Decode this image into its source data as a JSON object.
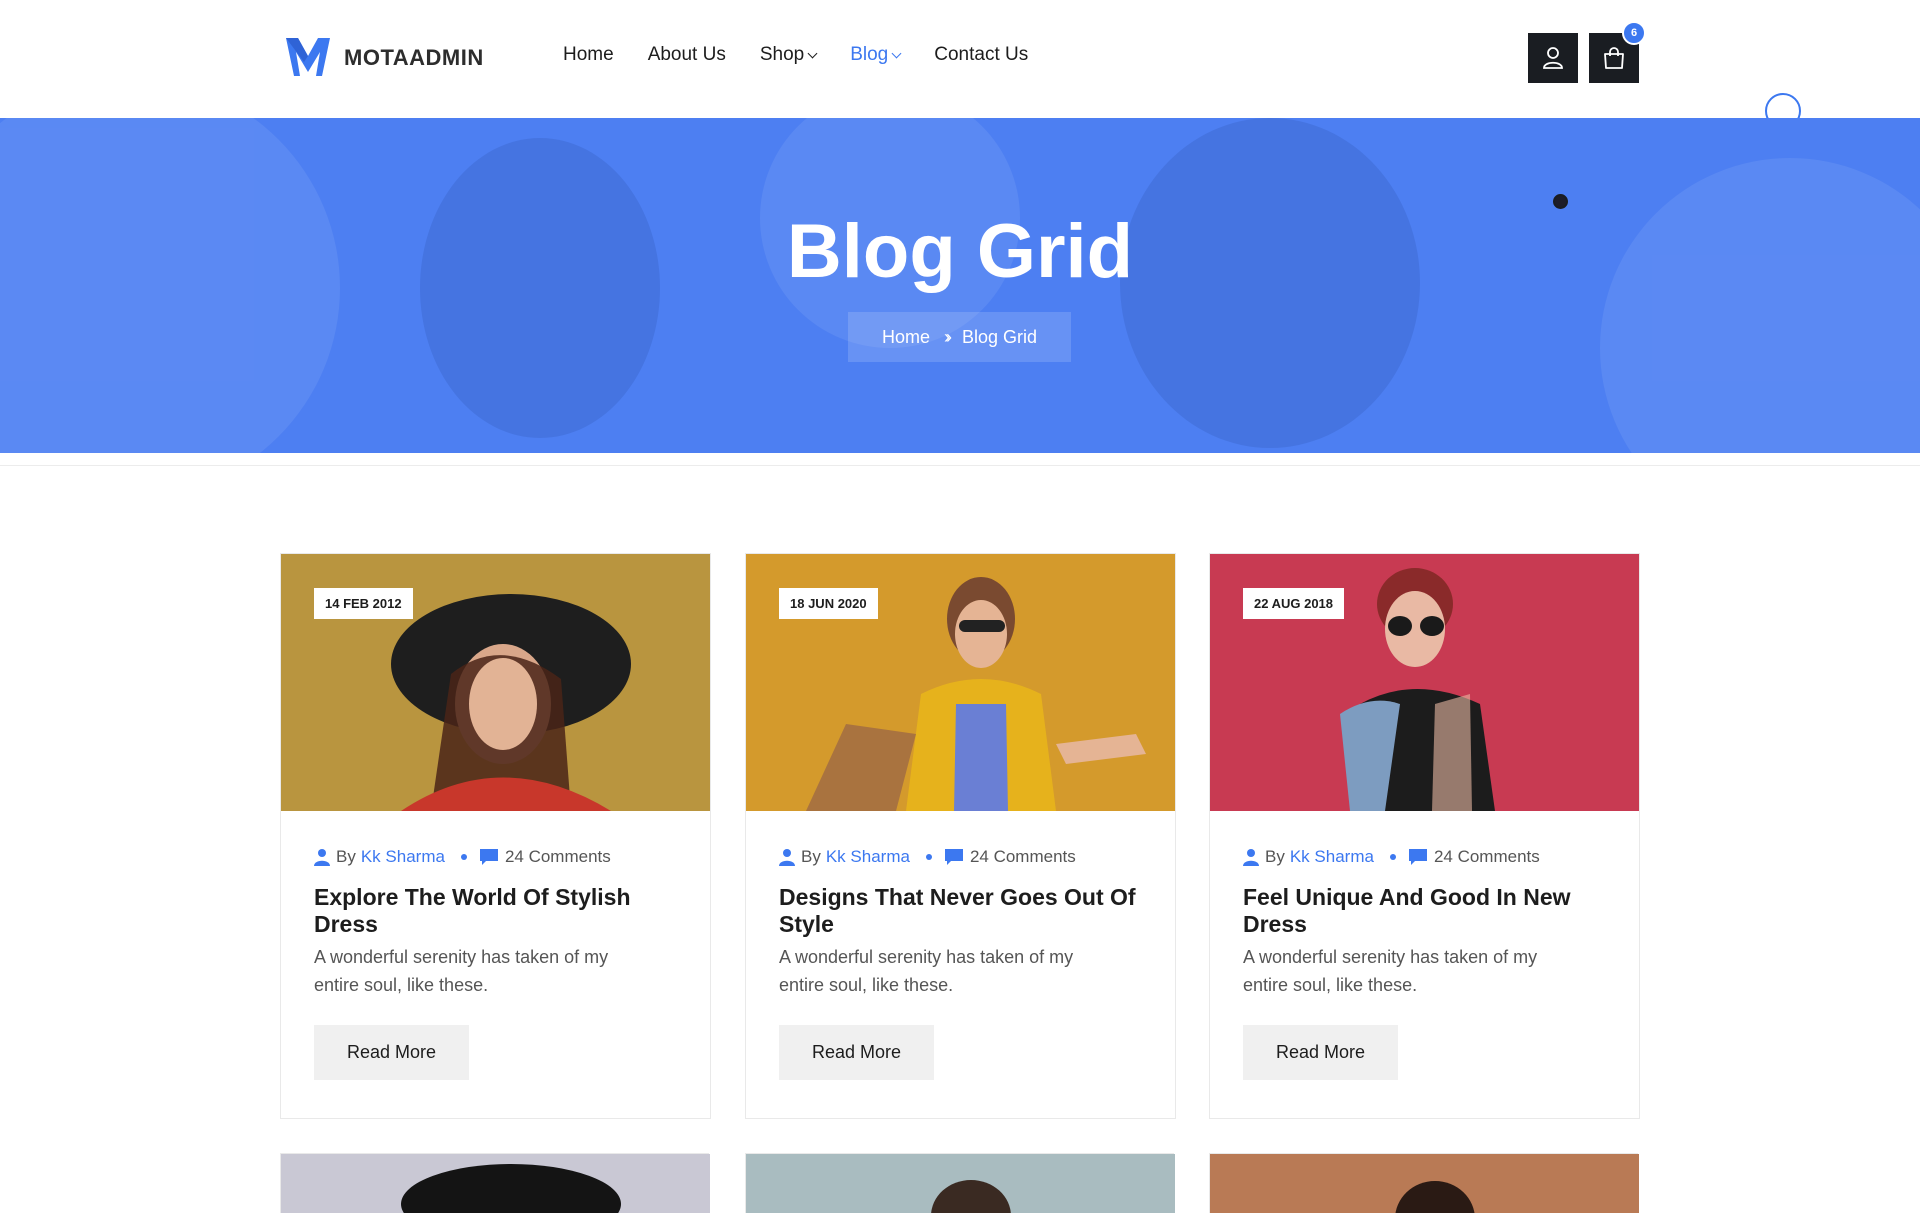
{
  "brand": {
    "name": "MOTAADMIN",
    "accent": "#3c78f0",
    "dark": "#1a1d22"
  },
  "nav": {
    "items": [
      {
        "label": "Home",
        "has_dropdown": false,
        "active": false
      },
      {
        "label": "About Us",
        "has_dropdown": false,
        "active": false
      },
      {
        "label": "Shop",
        "has_dropdown": true,
        "active": false
      },
      {
        "label": "Blog",
        "has_dropdown": true,
        "active": true
      },
      {
        "label": "Contact Us",
        "has_dropdown": false,
        "active": false
      }
    ]
  },
  "header": {
    "user_icon": "user-icon",
    "cart_icon": "shopping-bag-icon",
    "cart_count": "6"
  },
  "hero": {
    "title": "Blog Grid",
    "breadcrumb": {
      "home": "Home",
      "current": "Blog Grid"
    }
  },
  "posts": [
    {
      "date": "14 FEB 2012",
      "by": "By",
      "author": "Kk Sharma",
      "comments": "24 Comments",
      "title": "Explore The World Of Stylish Dress",
      "excerpt": "A wonderful serenity has taken of my entire soul, like these.",
      "button": "Read More",
      "image_color": "#b9953f"
    },
    {
      "date": "18 JUN 2020",
      "by": "By",
      "author": "Kk Sharma",
      "comments": "24 Comments",
      "title": "Designs That Never Goes Out Of Style",
      "excerpt": "A wonderful serenity has taken of my entire soul, like these.",
      "button": "Read More",
      "image_color": "#d49a2c"
    },
    {
      "date": "22 AUG 2018",
      "by": "By",
      "author": "Kk Sharma",
      "comments": "24 Comments",
      "title": "Feel Unique And Good In New Dress",
      "excerpt": "A wonderful serenity has taken of my entire soul, like these.",
      "button": "Read More",
      "image_color": "#c83a52"
    }
  ],
  "posts_row2": [
    {
      "image_color": "#c9c8d4"
    },
    {
      "image_color": "#a9bcc0"
    },
    {
      "image_color": "#b97a55"
    }
  ]
}
